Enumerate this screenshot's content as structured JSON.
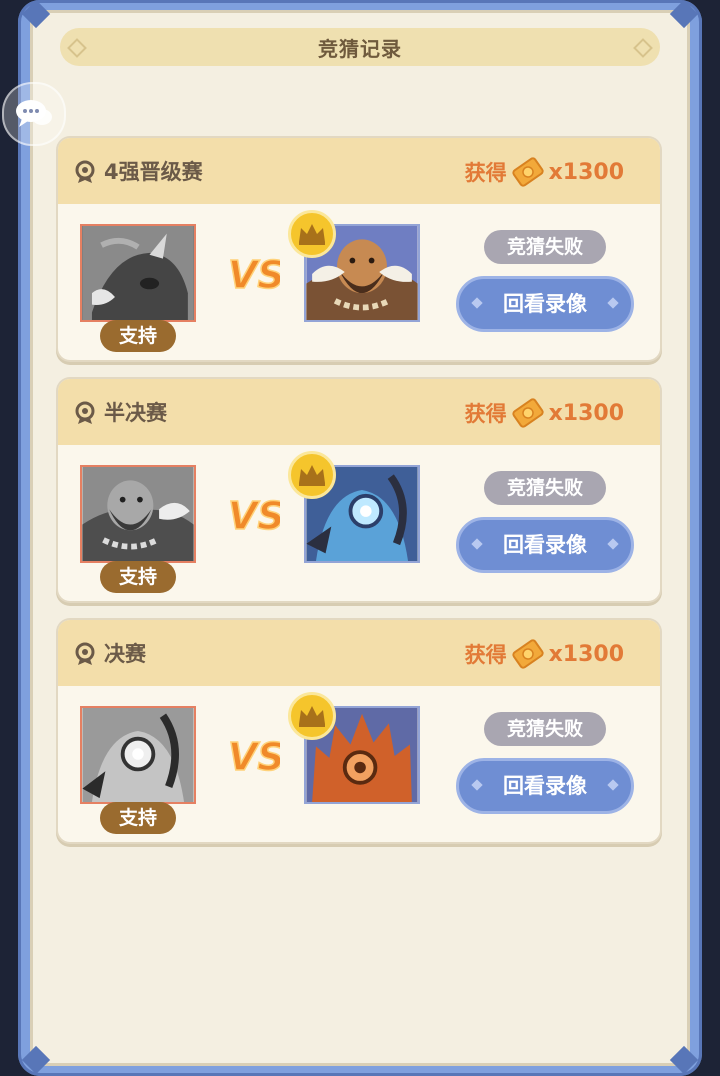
{
  "header": {
    "title": "竞猜记录"
  },
  "rounds": [
    {
      "name": "4强晋级赛",
      "reward_label": "获得",
      "reward_amount": "x1300",
      "support_label": "支持",
      "result": "竞猜失败",
      "replay_label": "回看录像"
    },
    {
      "name": "半决赛",
      "reward_label": "获得",
      "reward_amount": "x1300",
      "support_label": "支持",
      "result": "竞猜失败",
      "replay_label": "回看录像"
    },
    {
      "name": "决赛",
      "reward_label": "获得",
      "reward_amount": "x1300",
      "support_label": "支持",
      "result": "竞猜失败",
      "replay_label": "回看录像"
    }
  ],
  "icons": {
    "chat": "chat-bubbles-icon",
    "round": "medal-icon",
    "reward": "ticket-icon",
    "winner": "crown-icon",
    "versus": "vs-icon"
  },
  "colors": {
    "accent_orange": "#e27a37",
    "button_blue": "#6f8ed3",
    "failed_gray": "#a9a6b1",
    "support_brown": "#9a6b2f",
    "crown_gold": "#f5c52c"
  }
}
